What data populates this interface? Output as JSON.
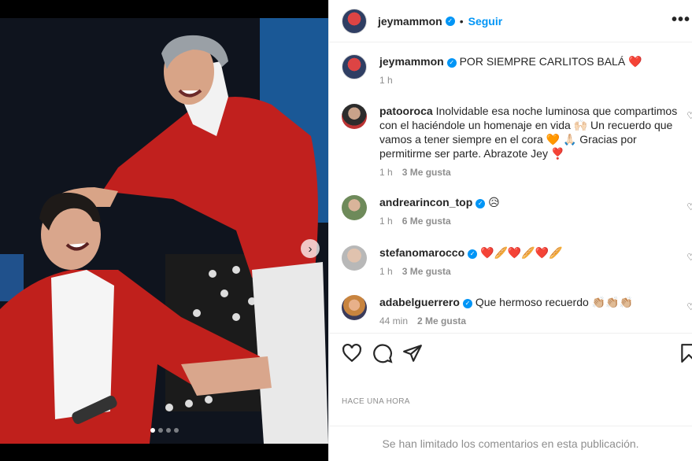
{
  "post": {
    "author": "jeymammon",
    "follow_label": "Seguir",
    "separator": "•",
    "more_label": "•••",
    "next_label": "›"
  },
  "caption": {
    "username": "jeymammon",
    "text": "POR SIEMPRE CARLITOS BALÁ ❤️",
    "time": "1 h"
  },
  "comments": [
    {
      "username": "patooroca",
      "verified": false,
      "text": "Inolvidable esa noche luminosa que compartimos con el haciéndole un homenaje en vida 🙌🏻 Un recuerdo que vamos a tener siempre en el cora 🧡 🙏🏻 Gracias por permitirme ser parte. Abrazote Jey ❣️",
      "time": "1 h",
      "likes": "3 Me gusta"
    },
    {
      "username": "andrearincon_top",
      "verified": true,
      "text": "😥",
      "time": "1 h",
      "likes": "6 Me gusta"
    },
    {
      "username": "stefanomarocco",
      "verified": true,
      "text": "❤️🥖❤️🥖❤️🥖",
      "time": "1 h",
      "likes": "3 Me gusta"
    },
    {
      "username": "adabelguerrero",
      "verified": true,
      "text": "Que hermoso recuerdo 👏🏼👏🏼👏🏼",
      "time": "44 min",
      "likes": "2 Me gusta"
    }
  ],
  "timestamp": "HACE UNA HORA",
  "comments_limited": "Se han limitado los comentarios en esta publicación.",
  "icons": {
    "like": "heart-icon",
    "comment": "comment-icon",
    "share": "share-icon",
    "save": "bookmark-icon"
  },
  "colors": {
    "link": "#0095f6",
    "secondary_text": "#8e8e8e"
  },
  "carousel": {
    "slides": 4,
    "active": 1
  }
}
